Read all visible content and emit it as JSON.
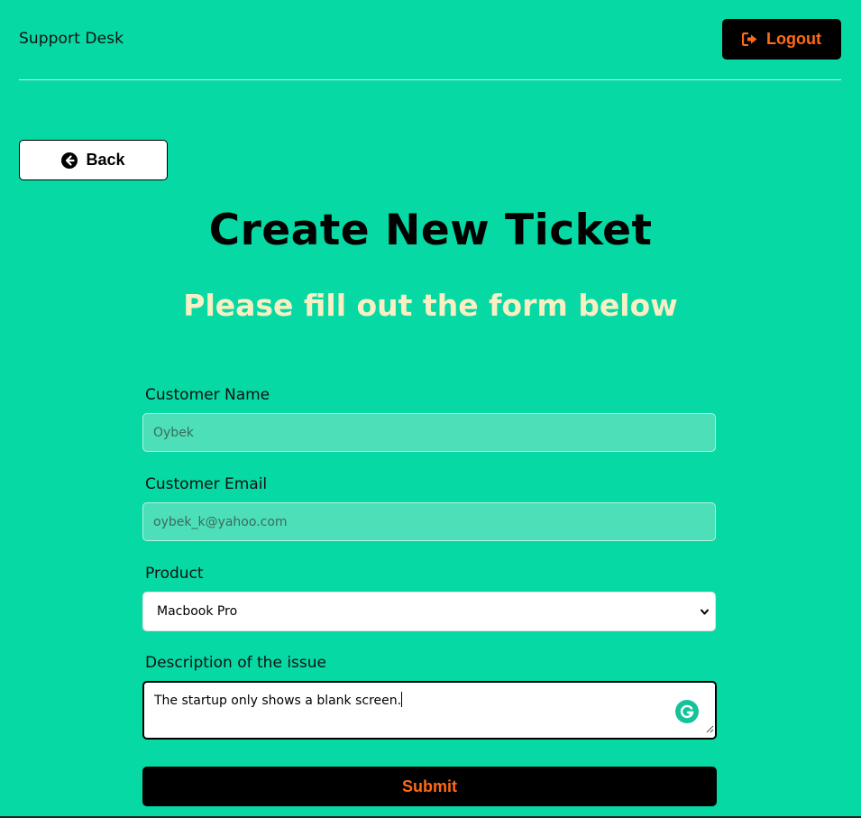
{
  "header": {
    "brand": "Support Desk",
    "logout_label": "Logout",
    "logout_icon": "sign-out-icon"
  },
  "back": {
    "label": "Back",
    "icon": "arrow-circle-left-icon"
  },
  "page": {
    "title": "Create New Ticket",
    "subtitle": "Please fill out the form below"
  },
  "form": {
    "name": {
      "label": "Customer Name",
      "value": "Oybek"
    },
    "email": {
      "label": "Customer Email",
      "value": "oybek_k@yahoo.com"
    },
    "product": {
      "label": "Product",
      "selected": "Macbook Pro"
    },
    "description": {
      "label": "Description of the issue",
      "value": "The startup only shows a blank screen."
    },
    "submit_label": "Submit"
  },
  "colors": {
    "background": "#06d9a4",
    "accent": "#ff6a13",
    "subtitle": "#f8f0c4",
    "dark": "#000000"
  }
}
